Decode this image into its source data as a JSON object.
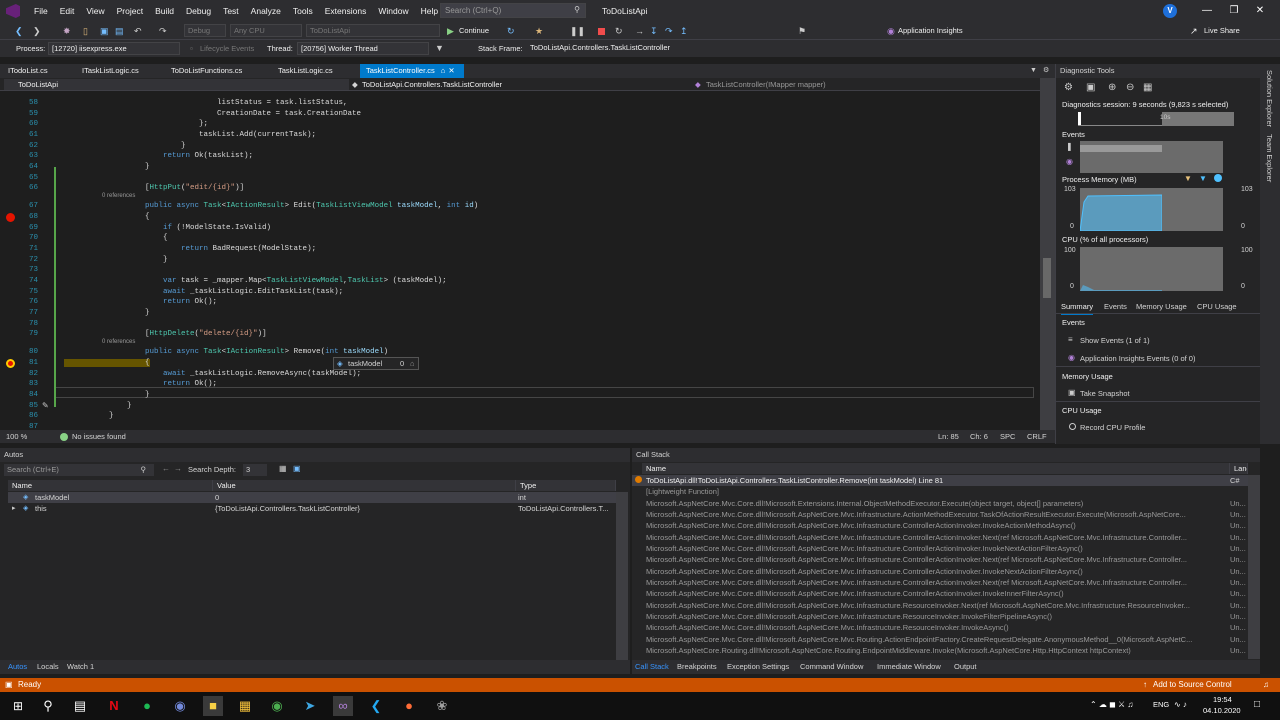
{
  "menu": {
    "items": [
      "File",
      "Edit",
      "View",
      "Project",
      "Build",
      "Debug",
      "Test",
      "Analyze",
      "Tools",
      "Extensions",
      "Window",
      "Help"
    ],
    "search_placeholder": "Search (Ctrl+Q)",
    "window_title": "ToDoListApi",
    "user_initial": "V"
  },
  "toolbar": {
    "config": "Debug",
    "platform": "Any CPU",
    "project": "ToDoListApi",
    "continue_label": "Continue",
    "app_insights": "Application Insights",
    "live_share": "Live Share",
    "process_label": "Process:",
    "process_value": "[12720] iisexpress.exe",
    "lifecycle": "Lifecycle Events",
    "thread_label": "Thread:",
    "thread_value": "[20756] Worker Thread",
    "stack_label": "Stack Frame:",
    "stack_value": "ToDoListApi.Controllers.TaskListController"
  },
  "tabs": [
    "ITodoList.cs",
    "ITaskListLogic.cs",
    "ToDoListFunctions.cs",
    "TaskListLogic.cs",
    "TaskListController.cs"
  ],
  "navbar": {
    "project": "ToDoListApi",
    "class": "ToDoListApi.Controllers.TaskListController",
    "member": "TaskListController(IMapper mapper)"
  },
  "editor": {
    "lines": [
      "58",
      "59",
      "60",
      "61",
      "62",
      "63",
      "64",
      "65",
      "66",
      "67",
      "68",
      "69",
      "70",
      "71",
      "72",
      "73",
      "74",
      "75",
      "76",
      "77",
      "78",
      "79",
      "80",
      "81",
      "82",
      "83",
      "84",
      "85",
      "86",
      "87"
    ],
    "references": "0 references",
    "datatip_name": "taskModel",
    "datatip_value": "0"
  },
  "statusline": {
    "zoom": "100 %",
    "issues": "No issues found",
    "ln": "Ln: 85",
    "ch": "Ch: 6",
    "spc": "SPC",
    "crlf": "CRLF"
  },
  "diagnostics": {
    "title": "Diagnostic Tools",
    "session": "Diagnostics session: 9 seconds (9,823 s selected)",
    "timeline_label": "10s",
    "events": "Events",
    "memory": "Process Memory (MB)",
    "mem_max": "103",
    "mem_min": "0",
    "cpu": "CPU (% of all processors)",
    "cpu_max": "100",
    "cpu_min": "0",
    "tabs": [
      "Summary",
      "Events",
      "Memory Usage",
      "CPU Usage"
    ],
    "sec_events": "Events",
    "show_events": "Show Events (1 of 1)",
    "ai_events": "Application Insights Events (0 of 0)",
    "sec_memory": "Memory Usage",
    "take_snapshot": "Take Snapshot",
    "sec_cpu": "CPU Usage",
    "record_cpu": "Record CPU Profile"
  },
  "side_tabs": [
    "Solution Explorer",
    "Team Explorer"
  ],
  "autos": {
    "title": "Autos",
    "search_placeholder": "Search (Ctrl+E)",
    "depth_label": "Search Depth:",
    "depth_value": "3",
    "headers": [
      "Name",
      "Value",
      "Type"
    ],
    "rows": [
      {
        "name": "taskModel",
        "value": "0",
        "type": "int"
      },
      {
        "name": "this",
        "value": "{ToDoListApi.Controllers.TaskListController}",
        "type": "ToDoListApi.Controllers.T..."
      }
    ],
    "bottom_tabs": [
      "Autos",
      "Locals",
      "Watch 1"
    ]
  },
  "callstack": {
    "title": "Call Stack",
    "headers": [
      "Name",
      "Lang"
    ],
    "rows": [
      {
        "name": "ToDoListApi.dll!ToDoListApi.Controllers.TaskListController.Remove(int taskModel) Line 81",
        "lang": "C#"
      },
      {
        "name": "[Lightweight Function]",
        "lang": ""
      },
      {
        "name": "Microsoft.AspNetCore.Mvc.Core.dll!Microsoft.Extensions.Internal.ObjectMethodExecutor.Execute(object target, object[] parameters)",
        "lang": "Un..."
      },
      {
        "name": "Microsoft.AspNetCore.Mvc.Core.dll!Microsoft.AspNetCore.Mvc.Infrastructure.ActionMethodExecutor.TaskOfActionResultExecutor.Execute(Microsoft.AspNetCore...",
        "lang": "Un..."
      },
      {
        "name": "Microsoft.AspNetCore.Mvc.Core.dll!Microsoft.AspNetCore.Mvc.Infrastructure.ControllerActionInvoker.InvokeActionMethodAsync()",
        "lang": "Un..."
      },
      {
        "name": "Microsoft.AspNetCore.Mvc.Core.dll!Microsoft.AspNetCore.Mvc.Infrastructure.ControllerActionInvoker.Next(ref Microsoft.AspNetCore.Mvc.Infrastructure.Controller...",
        "lang": "Un..."
      },
      {
        "name": "Microsoft.AspNetCore.Mvc.Core.dll!Microsoft.AspNetCore.Mvc.Infrastructure.ControllerActionInvoker.InvokeNextActionFilterAsync()",
        "lang": "Un..."
      },
      {
        "name": "Microsoft.AspNetCore.Mvc.Core.dll!Microsoft.AspNetCore.Mvc.Infrastructure.ControllerActionInvoker.Next(ref Microsoft.AspNetCore.Mvc.Infrastructure.Controller...",
        "lang": "Un..."
      },
      {
        "name": "Microsoft.AspNetCore.Mvc.Core.dll!Microsoft.AspNetCore.Mvc.Infrastructure.ControllerActionInvoker.InvokeNextActionFilterAsync()",
        "lang": "Un..."
      },
      {
        "name": "Microsoft.AspNetCore.Mvc.Core.dll!Microsoft.AspNetCore.Mvc.Infrastructure.ControllerActionInvoker.Next(ref Microsoft.AspNetCore.Mvc.Infrastructure.Controller...",
        "lang": "Un..."
      },
      {
        "name": "Microsoft.AspNetCore.Mvc.Core.dll!Microsoft.AspNetCore.Mvc.Infrastructure.ControllerActionInvoker.InvokeInnerFilterAsync()",
        "lang": "Un..."
      },
      {
        "name": "Microsoft.AspNetCore.Mvc.Core.dll!Microsoft.AspNetCore.Mvc.Infrastructure.ResourceInvoker.Next(ref Microsoft.AspNetCore.Mvc.Infrastructure.ResourceInvoker...",
        "lang": "Un..."
      },
      {
        "name": "Microsoft.AspNetCore.Mvc.Core.dll!Microsoft.AspNetCore.Mvc.Infrastructure.ResourceInvoker.InvokeFilterPipelineAsync()",
        "lang": "Un..."
      },
      {
        "name": "Microsoft.AspNetCore.Mvc.Core.dll!Microsoft.AspNetCore.Mvc.Infrastructure.ResourceInvoker.InvokeAsync()",
        "lang": "Un..."
      },
      {
        "name": "Microsoft.AspNetCore.Mvc.Core.dll!Microsoft.AspNetCore.Mvc.Routing.ActionEndpointFactory.CreateRequestDelegate.AnonymousMethod__0(Microsoft.AspNetC...",
        "lang": "Un..."
      },
      {
        "name": "Microsoft.AspNetCore.Routing.dll!Microsoft.AspNetCore.Routing.EndpointMiddleware.Invoke(Microsoft.AspNetCore.Http.HttpContext httpContext)",
        "lang": "Un..."
      }
    ],
    "bottom_tabs": [
      "Call Stack",
      "Breakpoints",
      "Exception Settings",
      "Command Window",
      "Immediate Window",
      "Output"
    ]
  },
  "statusbar": {
    "ready": "Ready",
    "source_control": "Add to Source Control"
  },
  "taskbar": {
    "lang": "ENG",
    "time": "19:54",
    "date": "04.10.2020"
  },
  "colors": {
    "accent": "#007acc",
    "status_debug": "#ca5100",
    "breakpoint": "#e51400"
  }
}
